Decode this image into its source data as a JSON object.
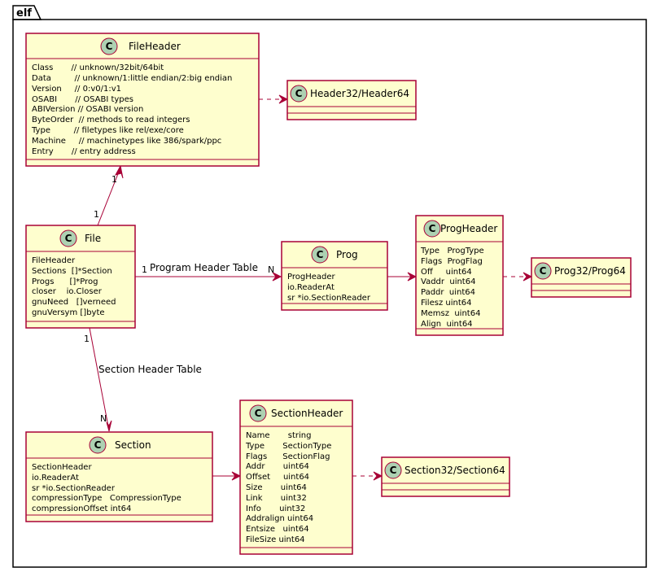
{
  "package": {
    "name": "elf"
  },
  "classes": {
    "file_header": {
      "name": "FileHeader",
      "fields": [
        "Class       // unknown/32bit/64bit",
        "Data         // unknown/1:little endian/2:big endian",
        "Version     // 0:v0/1:v1",
        "OSABI       // OSABI types",
        "ABIVersion // OSABI version",
        "ByteOrder  // methods to read integers",
        "Type         // filetypes like rel/exe/core",
        "Machine     // machinetypes like 386/spark/ppc",
        "Entry       // entry address"
      ]
    },
    "header32_64": {
      "name": "Header32/Header64",
      "fields": []
    },
    "file": {
      "name": "File",
      "fields": [
        "FileHeader",
        "Sections  []*Section",
        "Progs      []*Prog",
        "closer    io.Closer",
        "gnuNeed   []verneed",
        "gnuVersym []byte"
      ]
    },
    "prog": {
      "name": "Prog",
      "fields": [
        "ProgHeader",
        "io.ReaderAt",
        "sr *io.SectionReader"
      ]
    },
    "prog_header": {
      "name": "ProgHeader",
      "fields": [
        "Type   ProgType",
        "Flags  ProgFlag",
        "Off     uint64",
        "Vaddr  uint64",
        "Paddr  uint64",
        "Filesz uint64",
        "Memsz  uint64",
        "Align  uint64"
      ]
    },
    "prog32_64": {
      "name": "Prog32/Prog64",
      "fields": []
    },
    "section": {
      "name": "Section",
      "fields": [
        "SectionHeader",
        "io.ReaderAt",
        "sr *io.SectionReader",
        "compressionType   CompressionType",
        "compressionOffset int64"
      ]
    },
    "section_header": {
      "name": "SectionHeader",
      "fields": [
        "Name       string",
        "Type       SectionType",
        "Flags      SectionFlag",
        "Addr       uint64",
        "Offset     uint64",
        "Size       uint64",
        "Link       uint32",
        "Info       uint32",
        "Addralign uint64",
        "Entsize   uint64",
        "FileSize uint64"
      ]
    },
    "section32_64": {
      "name": "Section32/Section64",
      "fields": []
    }
  },
  "relations": {
    "file_to_header": {
      "from_mult": "1",
      "to_mult": "1"
    },
    "file_to_prog": {
      "label": "Program Header Table",
      "from_mult": "1",
      "to_mult": "N"
    },
    "file_to_section": {
      "label": "Section Header Table",
      "from_mult": "1",
      "to_mult": "N"
    }
  },
  "class_glyph": "C",
  "colors": {
    "box_fill": "#FEFECE",
    "border": "#A80036",
    "class_icon": "#ADD1B2"
  }
}
